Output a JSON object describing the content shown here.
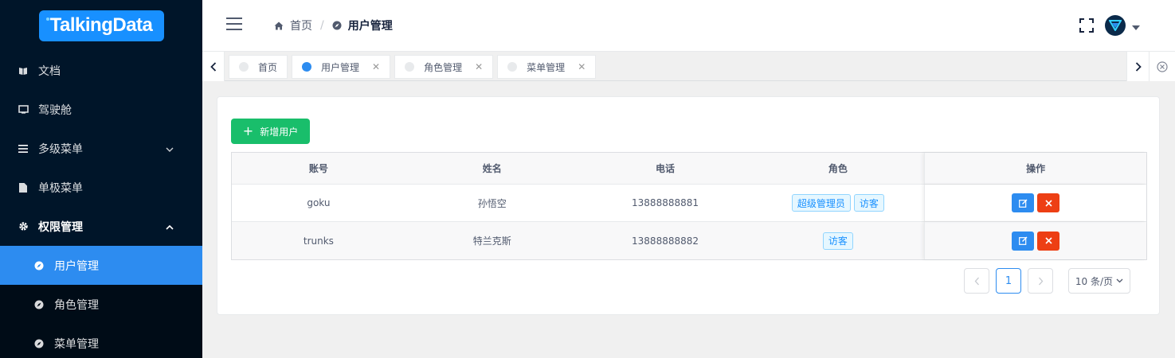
{
  "logo": {
    "text": "TalkingData"
  },
  "sidebar": {
    "items": [
      {
        "label": "文档",
        "icon": "book-icon"
      },
      {
        "label": "驾驶舱",
        "icon": "monitor-icon"
      },
      {
        "label": "多级菜单",
        "icon": "menu-icon"
      },
      {
        "label": "单极菜单",
        "icon": "document-icon"
      },
      {
        "label": "权限管理",
        "icon": "gear-icon"
      }
    ],
    "submenu": [
      {
        "label": "用户管理",
        "icon": "compass-icon"
      },
      {
        "label": "角色管理",
        "icon": "compass-icon"
      },
      {
        "label": "菜单管理",
        "icon": "compass-icon"
      }
    ],
    "active_color": "#2d8cf0",
    "bg_color": "#001529"
  },
  "header": {
    "breadcrumb": [
      {
        "label": "首页",
        "icon": "home-icon"
      },
      {
        "label": "用户管理",
        "icon": "compass-icon"
      }
    ]
  },
  "tags": [
    {
      "label": "首页",
      "closable": false,
      "active": false
    },
    {
      "label": "用户管理",
      "closable": true,
      "active": true
    },
    {
      "label": "角色管理",
      "closable": true,
      "active": false
    },
    {
      "label": "菜单管理",
      "closable": true,
      "active": false
    }
  ],
  "content": {
    "add_button": "新增用户",
    "columns": [
      "账号",
      "姓名",
      "电话",
      "角色",
      "操作"
    ],
    "rows": [
      {
        "account": "goku",
        "name": "孙悟空",
        "phone": "13888888881",
        "roles": [
          "超级管理员",
          "访客"
        ]
      },
      {
        "account": "trunks",
        "name": "特兰克斯",
        "phone": "13888888882",
        "roles": [
          "访客"
        ]
      }
    ],
    "pager": {
      "current": "1",
      "page_size": "10 条/页"
    }
  },
  "colors": {
    "success": "#19be6b",
    "primary": "#2d8cf0",
    "danger": "#ed3f14"
  }
}
